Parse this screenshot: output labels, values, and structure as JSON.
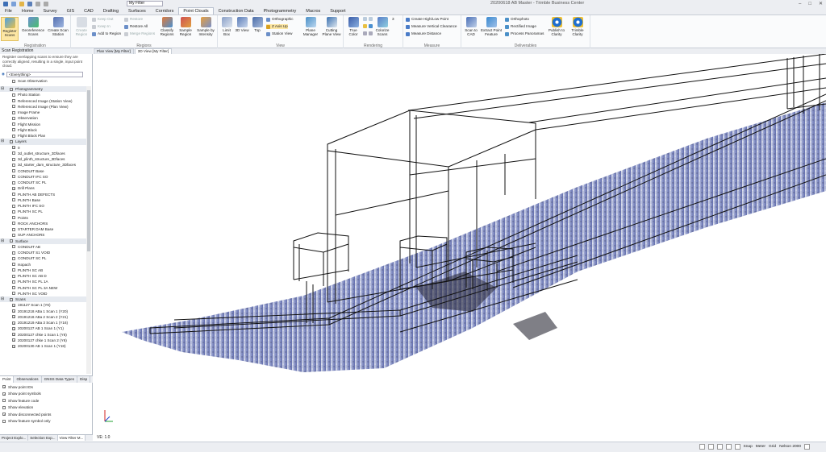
{
  "window": {
    "title": "20200618 AB Master - Trimble Business Center",
    "filter_value": "My Filter"
  },
  "ribbon_tabs": [
    "File",
    "Home",
    "Survey",
    "GIS",
    "CAD",
    "Drafting",
    "Surfaces",
    "Corridors",
    "Point Clouds",
    "Construction Data",
    "Photogrammetry",
    "Macros",
    "Support"
  ],
  "ribbon_active_tab": "Point Clouds",
  "ribbon": {
    "registration": {
      "label": "Registration",
      "register_scans": "Register Scans",
      "georeference_scans": "Georeference Scans",
      "create_scan_station": "Create Scan Station"
    },
    "regions": {
      "label": "Regions",
      "create_region": "Create Region",
      "keep_out": "Keep Out",
      "keep_in": "Keep In",
      "add_to_region": "Add to Region",
      "restore": "Restore",
      "restore_all": "Restore All",
      "merge_regions": "Merge Regions",
      "classify_regions": "Classify Regions",
      "sample_region": "Sample Region",
      "sample_by_intensity": "Sample by Intensity"
    },
    "view": {
      "label": "View",
      "limit_box": "Limit Box",
      "view_3d": "3D View",
      "top": "Top",
      "orthographic": "Orthographic",
      "z_axis_up": "Z Axis Up",
      "station_view": "Station View",
      "plane_manager": "Plane Manager",
      "cutting_plane_view": "Cutting Plane View"
    },
    "rendering": {
      "label": "Rendering",
      "true_color": "True Color",
      "colorize_scans": "Colorize Scans",
      "point_size": "3"
    },
    "measure": {
      "label": "Measure",
      "create_high_low": "Create High/Low Point",
      "measure_vertical": "Measure Vertical Clearance",
      "measure_distance": "Measure Distance"
    },
    "deliverables": {
      "label": "Deliverables",
      "scan_to_cad": "Scan to CAD",
      "extract_point_feature": "Extract Point Feature",
      "orthophoto": "Orthophoto",
      "rectified_image": "Rectified Image",
      "process_panoramas": "Process Panoramas",
      "publish_to_clarity": "Publish to Clarity",
      "trimble_clarity": "Trimble Clarity"
    }
  },
  "left_panel": {
    "title": "Scan Registration",
    "description": "Register overlapping scans to ensure they are correctly aligned, resulting in a single, input point cloud.",
    "filter_value": "<Everything>",
    "first_item": "Scan Observation",
    "groups": [
      {
        "name": "Photogrammetry",
        "items": [
          "Photo Station",
          "Referenced Image (Station View)",
          "Referenced Image (Plan View)",
          "Image Frame",
          "Observation",
          "Flight Mission",
          "Flight Block",
          "Flight Block Plan"
        ]
      },
      {
        "name": "Layers",
        "items": [
          "0",
          "3d_outlet_structure_3Dfaces",
          "3d_plinth_structure_3Dfaces",
          "3d_starter_dam_structure_3Dfaces",
          "CONDUIT Base",
          "CONDUIT IFC SO",
          "CONDUIT SC PL",
          "Drill Plans",
          "PLINTH AB DEFECTS",
          "PLINTH Base",
          "PLINTH IFC SO",
          "PLINTH SC PL",
          "Points",
          "ROCK ANCHORS",
          "STARTER DAM Base",
          "SUP ANCHORS"
        ]
      },
      {
        "name": "Surface",
        "items": [
          "CONDUIT AB",
          "CONDUIT S1 VOID",
          "CONDUIT SC PL",
          "Isopach",
          "PLINTH SC AB",
          "PLINTH SC AB D",
          "PLINTH SC PL 1A",
          "PLINTH SC PL 3A NEW",
          "PLINTH SC VOID"
        ]
      },
      {
        "name": "Scans",
        "items": [
          "191127 Scan 1 (Y6)",
          "20191218 ABa 1 Scan 1 (Y20)",
          "20191218 ABa 2 Scan 2 (Y21)",
          "20191219 ABa 3 Scan 1 (Y16)",
          "20200127 AB 1 Scan 1 (Y1)",
          "20200127 chke 1 Scan 1 (Y6)",
          "20200127 chke 1 Scan 2 (Y6)",
          "20200130 AB 1 Scan 1 (Y18)"
        ]
      }
    ],
    "bottom_tabs": [
      "Point",
      "Observations",
      "GNSS Data Types",
      "Disp"
    ],
    "point_options": [
      {
        "label": "Show point IDs",
        "checked": true
      },
      {
        "label": "Show point symbols",
        "checked": true
      },
      {
        "label": "Show feature code",
        "checked": false
      },
      {
        "label": "Show elevation",
        "checked": false
      },
      {
        "label": "Show disconnected points",
        "checked": true
      },
      {
        "label": "Show feature symbol only",
        "checked": false
      }
    ],
    "panel_tabs": [
      "Project Explo...",
      "Selection Exp...",
      "View Filter M..."
    ]
  },
  "view_tabs": [
    "Plan View [My Filter]",
    "3D View [My Filter]"
  ],
  "view_active_tab": "3D View [My Filter]",
  "view": {
    "ve_label": "VE: 1.0"
  },
  "statusbar": {
    "snap": "Snap",
    "units": "Meter",
    "grid": "Grid",
    "datum": "Nelson 2000"
  },
  "colors": {
    "accent": "#fde7a4",
    "ribbon_bg": "#fafbfc",
    "cloud_blue": "#8a95c8"
  }
}
